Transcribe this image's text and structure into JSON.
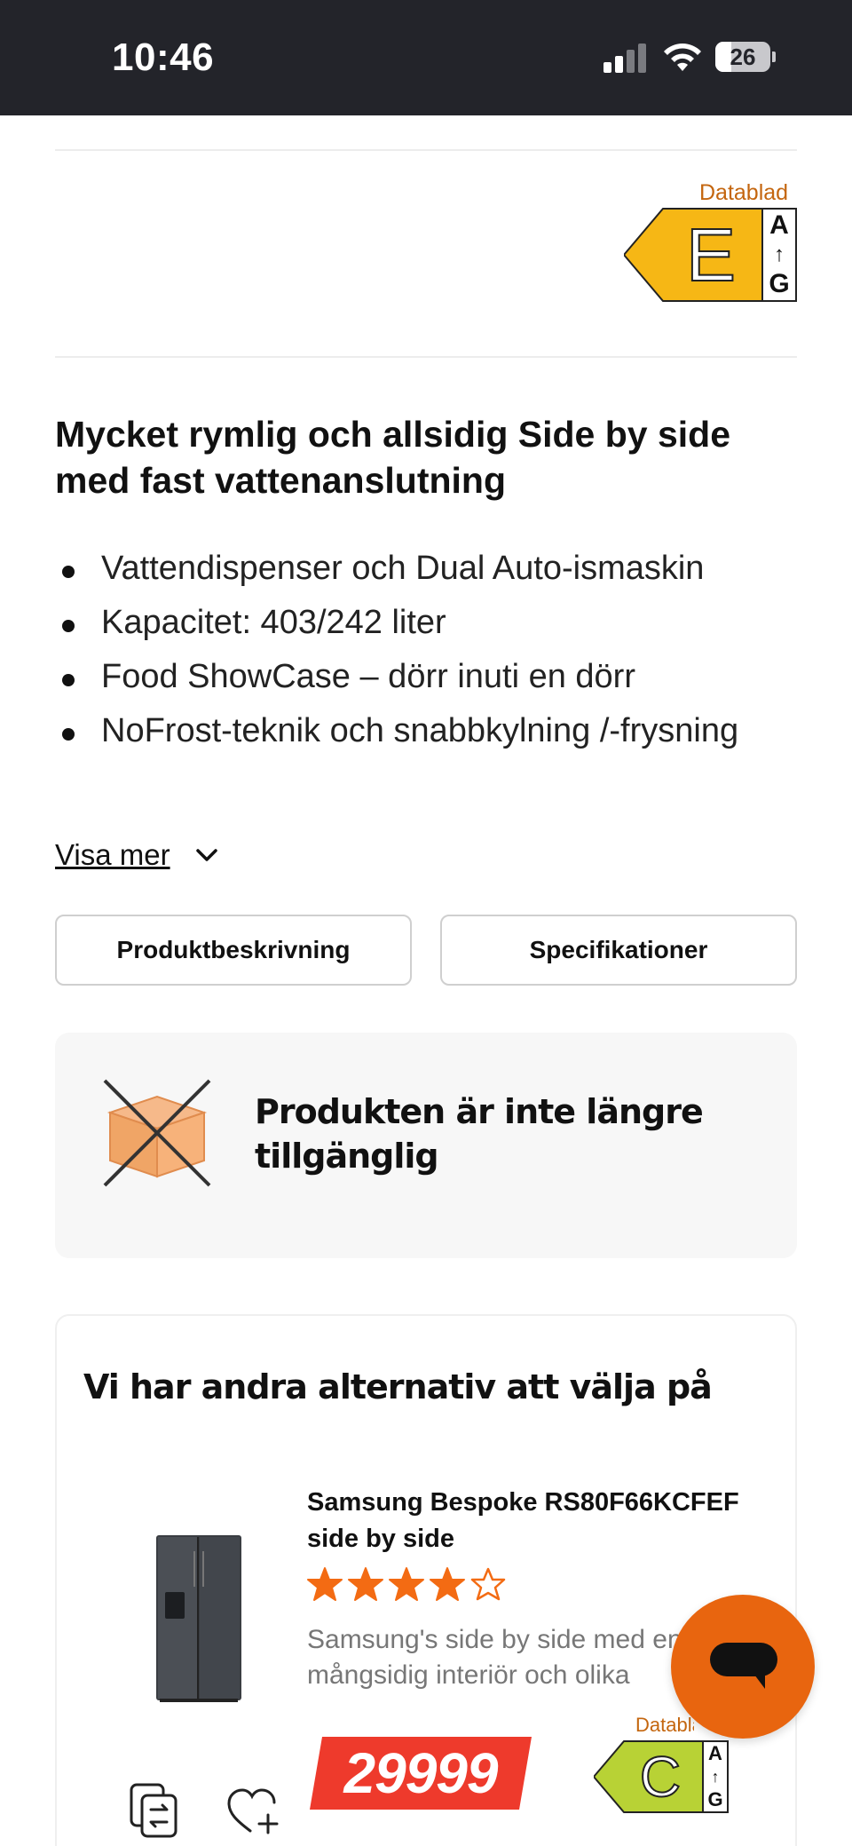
{
  "status_bar": {
    "time": "10:46",
    "battery": "26"
  },
  "energy_label": {
    "datablad": "Datablad",
    "grade": "E",
    "scale_top": "A",
    "scale_bottom": "G",
    "arrow": "↑",
    "color": "#f6b715"
  },
  "product": {
    "headline": "Mycket rymlig och allsidig Side by side med fast vattenanslutning",
    "bullets": [
      "Vattendispenser och Dual Auto-ismaskin",
      "Kapacitet: 403/242 liter",
      "Food ShowCase – dörr inuti en dörr",
      "NoFrost-teknik och snabbkylning /-frysning"
    ],
    "show_more": "Visa mer"
  },
  "tabs": {
    "description": "Produktbeskrivning",
    "specs": "Specifikationer"
  },
  "unavailable": {
    "message": "Produkten är inte längre tillgänglig",
    "icon": "crossed-box-icon"
  },
  "alternatives": {
    "title": "Vi har andra alternativ att välja på",
    "item": {
      "name": "Samsung Bespoke RS80F66KCFEF side by side",
      "rating": 4,
      "rating_max": 5,
      "description_line1": "Samsung's side by side med en",
      "description_line2": "mångsidig interiör och olika",
      "price": "29999",
      "price_color": "#ee3a2c",
      "energy": {
        "datablad": "Datablad",
        "grade": "C",
        "scale_top": "A",
        "scale_bottom": "G",
        "arrow": "↑",
        "color": "#b8d235"
      }
    }
  },
  "colors": {
    "accent": "#e8650f",
    "star": "#f36b13",
    "status_bar": "#23242a"
  }
}
